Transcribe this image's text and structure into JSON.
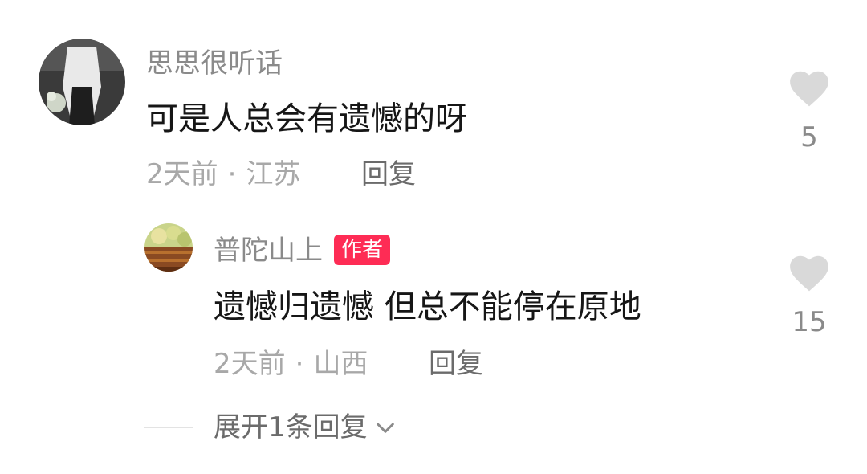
{
  "comments": [
    {
      "username": "思思很听话",
      "text": "可是人总会有遗憾的呀",
      "time": "2天前",
      "separator": "·",
      "location": "江苏",
      "reply_label": "回复",
      "likes": "5",
      "avatar_icon": "user-photo-avatar"
    }
  ],
  "replies": [
    {
      "username": "普陀山上",
      "badge": "作者",
      "text": "遗憾归遗憾 但总不能停在原地",
      "time": "2天前",
      "separator": "·",
      "location": "山西",
      "reply_label": "回复",
      "likes": "15",
      "avatar_icon": "temple-photo-avatar"
    }
  ],
  "expand": {
    "label": "展开1条回复",
    "icon": "chevron-down-icon"
  },
  "colors": {
    "badge": "#fe2c55",
    "heart": "#d9d9d9",
    "username": "#8a8a8a",
    "meta": "#a8a8a8"
  }
}
